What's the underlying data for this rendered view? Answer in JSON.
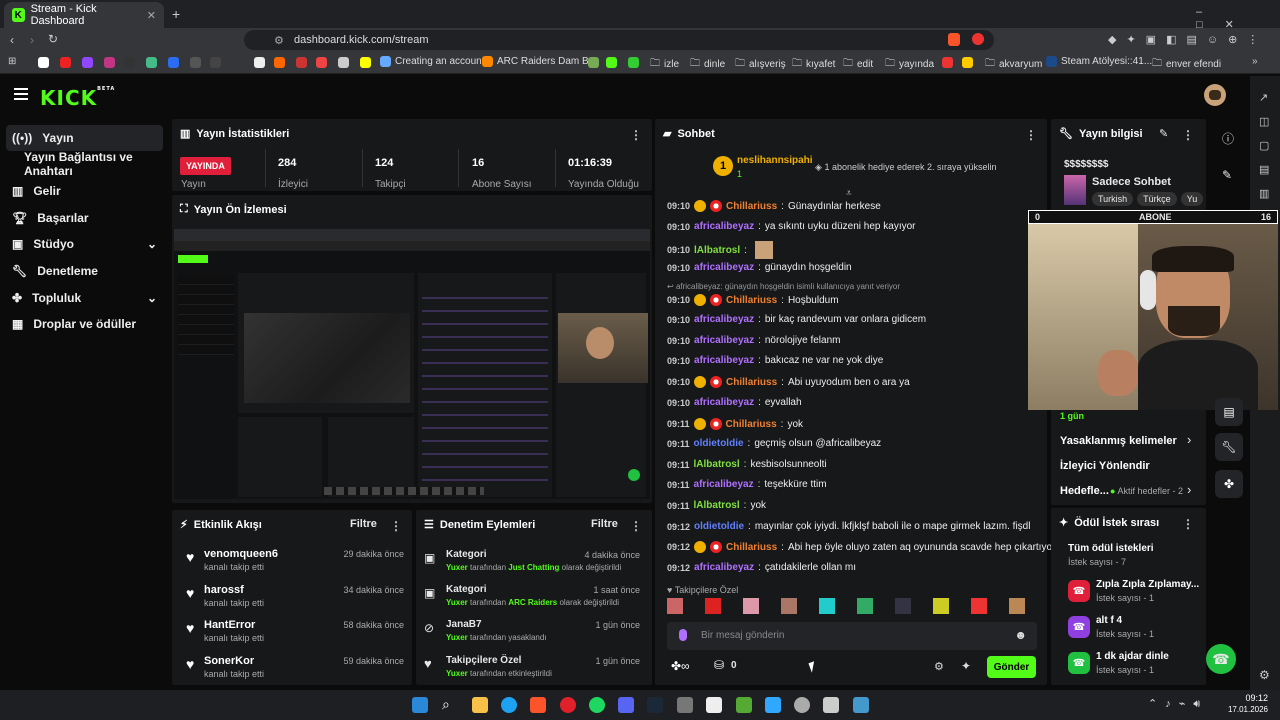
{
  "browser": {
    "tab_title": "Stream - Kick Dashboard",
    "url": "dashboard.kick.com/stream",
    "bookmarks": [
      "Creating an account...",
      "ARC Raiders Dam B...",
      "izle",
      "dinle",
      "alışveriş",
      "kıyafet",
      "edit",
      "yayında",
      "akvaryum",
      "Steam Atölyesi::41...",
      "enver efendi"
    ]
  },
  "app": {
    "logo": "KICK",
    "logo_sup": "BETA"
  },
  "sidebar": {
    "items": [
      {
        "label": "Yayın"
      },
      {
        "label": "Yayın Bağlantısı ve Anahtarı"
      },
      {
        "label": "Gelir"
      },
      {
        "label": "Başarılar"
      },
      {
        "label": "Stüdyo"
      },
      {
        "label": "Denetleme"
      },
      {
        "label": "Topluluk"
      },
      {
        "label": "Droplar ve ödüller"
      }
    ]
  },
  "stats": {
    "title": "Yayın İstatistikleri",
    "live_label": "YAYINDA",
    "live_sub": "Yayın",
    "items": [
      {
        "value": "284",
        "label": "İzleyici"
      },
      {
        "value": "124",
        "label": "Takipçi"
      },
      {
        "value": "16",
        "label": "Abone Sayısı"
      },
      {
        "value": "01:16:39",
        "label": "Yayında Olduğu"
      }
    ]
  },
  "preview": {
    "title": "Yayın Ön İzlemesi"
  },
  "activity": {
    "title": "Etkinlik Akışı",
    "filter": "Filtre",
    "items": [
      {
        "name": "venomqueen6",
        "desc": "kanalı takip etti",
        "time": "29 dakika önce"
      },
      {
        "name": "harossf",
        "desc": "kanalı takip etti",
        "time": "34 dakika önce"
      },
      {
        "name": "HantError",
        "desc": "kanalı takip etti",
        "time": "58 dakika önce"
      },
      {
        "name": "SonerKor",
        "desc": "kanalı takip etti",
        "time": "59 dakika önce"
      }
    ]
  },
  "moderation": {
    "title": "Denetim Eylemleri",
    "filter": "Filtre",
    "items": [
      {
        "title": "Kategori",
        "user": "Yuxer",
        "mid": "tarafından",
        "target": "Just Chatting",
        "suffix": "olarak değiştirildi",
        "time": "4 dakika önce"
      },
      {
        "title": "Kategori",
        "user": "Yuxer",
        "mid": "tarafından",
        "target": "ARC Raiders",
        "suffix": "olarak değiştirildi",
        "time": "1 saat önce"
      },
      {
        "title": "JanaB7",
        "user": "Yuxer",
        "mid": "tarafından yasaklandı",
        "target": "",
        "suffix": "",
        "time": "1 gün önce"
      },
      {
        "title": "Takipçilere Özel",
        "user": "Yuxer",
        "mid": "tarafından etkinleştirildi",
        "target": "",
        "suffix": "",
        "time": "1 gün önce"
      }
    ]
  },
  "chat": {
    "title": "Sohbet",
    "pinned_user": "neslihannsipahi",
    "pinned_count": "1",
    "pinned_text": "1 abonelik hediye ederek 2. sıraya yükselin",
    "reply_note": "africalibeyaz: günaydın hoşgeldin isimli kullanıcıya yanıt veriyor",
    "messages": [
      {
        "time": "09:10",
        "user": "Chillariuss",
        "text": "Günaydınlar herkese",
        "color": "#f08030"
      },
      {
        "time": "09:10",
        "user": "africalibeyaz",
        "text": "ya sıkıntı uyku düzeni hep kayıyor",
        "color": "#b070ff"
      },
      {
        "time": "09:10",
        "user": "lAlbatrosl",
        "text": "",
        "color": "#80e040"
      },
      {
        "time": "09:10",
        "user": "africalibeyaz",
        "text": "günaydın hoşgeldin",
        "color": "#b070ff"
      },
      {
        "time": "09:10",
        "user": "Chillariuss",
        "text": "Hoşbuldum",
        "color": "#f08030"
      },
      {
        "time": "09:10",
        "user": "africalibeyaz",
        "text": "bir kaç randevum var onlara gidicem",
        "color": "#b070ff"
      },
      {
        "time": "09:10",
        "user": "africalibeyaz",
        "text": "nörolojiye felanm",
        "color": "#b070ff"
      },
      {
        "time": "09:10",
        "user": "africalibeyaz",
        "text": "bakıcaz ne var ne yok diye",
        "color": "#b070ff"
      },
      {
        "time": "09:10",
        "user": "Chillariuss",
        "text": "Abi uyuyodum ben o ara ya",
        "color": "#f08030"
      },
      {
        "time": "09:10",
        "user": "africalibeyaz",
        "text": "eyvallah",
        "color": "#b070ff"
      },
      {
        "time": "09:11",
        "user": "Chillariuss",
        "text": "yok",
        "color": "#f08030"
      },
      {
        "time": "09:11",
        "user": "oldietoldie",
        "text": "geçmiş olsun @africalibeyaz",
        "color": "#6080ff"
      },
      {
        "time": "09:11",
        "user": "lAlbatrosl",
        "text": "kesbisolsunneolti",
        "color": "#80e040"
      },
      {
        "time": "09:11",
        "user": "africalibeyaz",
        "text": "teşekküre ttim",
        "color": "#b070ff"
      },
      {
        "time": "09:11",
        "user": "lAlbatrosl",
        "text": "yok",
        "color": "#80e040"
      },
      {
        "time": "09:12",
        "user": "oldietoldie",
        "text": "mayınlar çok iyiydi. lkfjklşf baboli ile o mape girmek lazım. fişdl",
        "color": "#6080ff"
      },
      {
        "time": "09:12",
        "user": "Chillariuss",
        "text": "Abi hep öyle oluyo zaten aq oyununda scavde hep çıkartıyo",
        "color": "#f08030"
      },
      {
        "time": "09:12",
        "user": "africalibeyaz",
        "text": "çatıdakilerle ollan mı",
        "color": "#b070ff"
      }
    ],
    "followers_only": "Takipçilere Özel",
    "input_placeholder": "Bir mesaj gönderin",
    "points": "0",
    "send": "Gönder"
  },
  "streaminfo": {
    "title": "Yayın bilgisi",
    "stream_title": "$$$$$$$$",
    "category": "Sadece Sohbet",
    "tags": [
      "Turkish",
      "Türkçe",
      "Yu"
    ],
    "sub_goal_left": "0",
    "sub_goal_label": "ABONE",
    "sub_goal_right": "16",
    "duration": "1 gün",
    "links": [
      "Yasaklanmış kelimeler",
      "İzleyici Yönlendir",
      "Hedefle..."
    ],
    "goal_status": "Aktif hedefler - 2"
  },
  "rewards": {
    "title": "Ödül İstek sırası",
    "all": "Tüm ödül istekleri",
    "all_count": "İstek sayısı - 7",
    "items": [
      {
        "name": "Zıpla Zıpla Zıplamay...",
        "count": "İstek sayısı - 1",
        "color": "#e0203a"
      },
      {
        "name": "alt f 4",
        "count": "İstek sayısı - 1",
        "color": "#9040e0"
      },
      {
        "name": "1 dk ajdar dinle",
        "count": "İstek sayısı - 1",
        "color": "#20c040"
      }
    ]
  },
  "taskbar": {
    "time": "09:12",
    "date": "17.01.2026"
  }
}
